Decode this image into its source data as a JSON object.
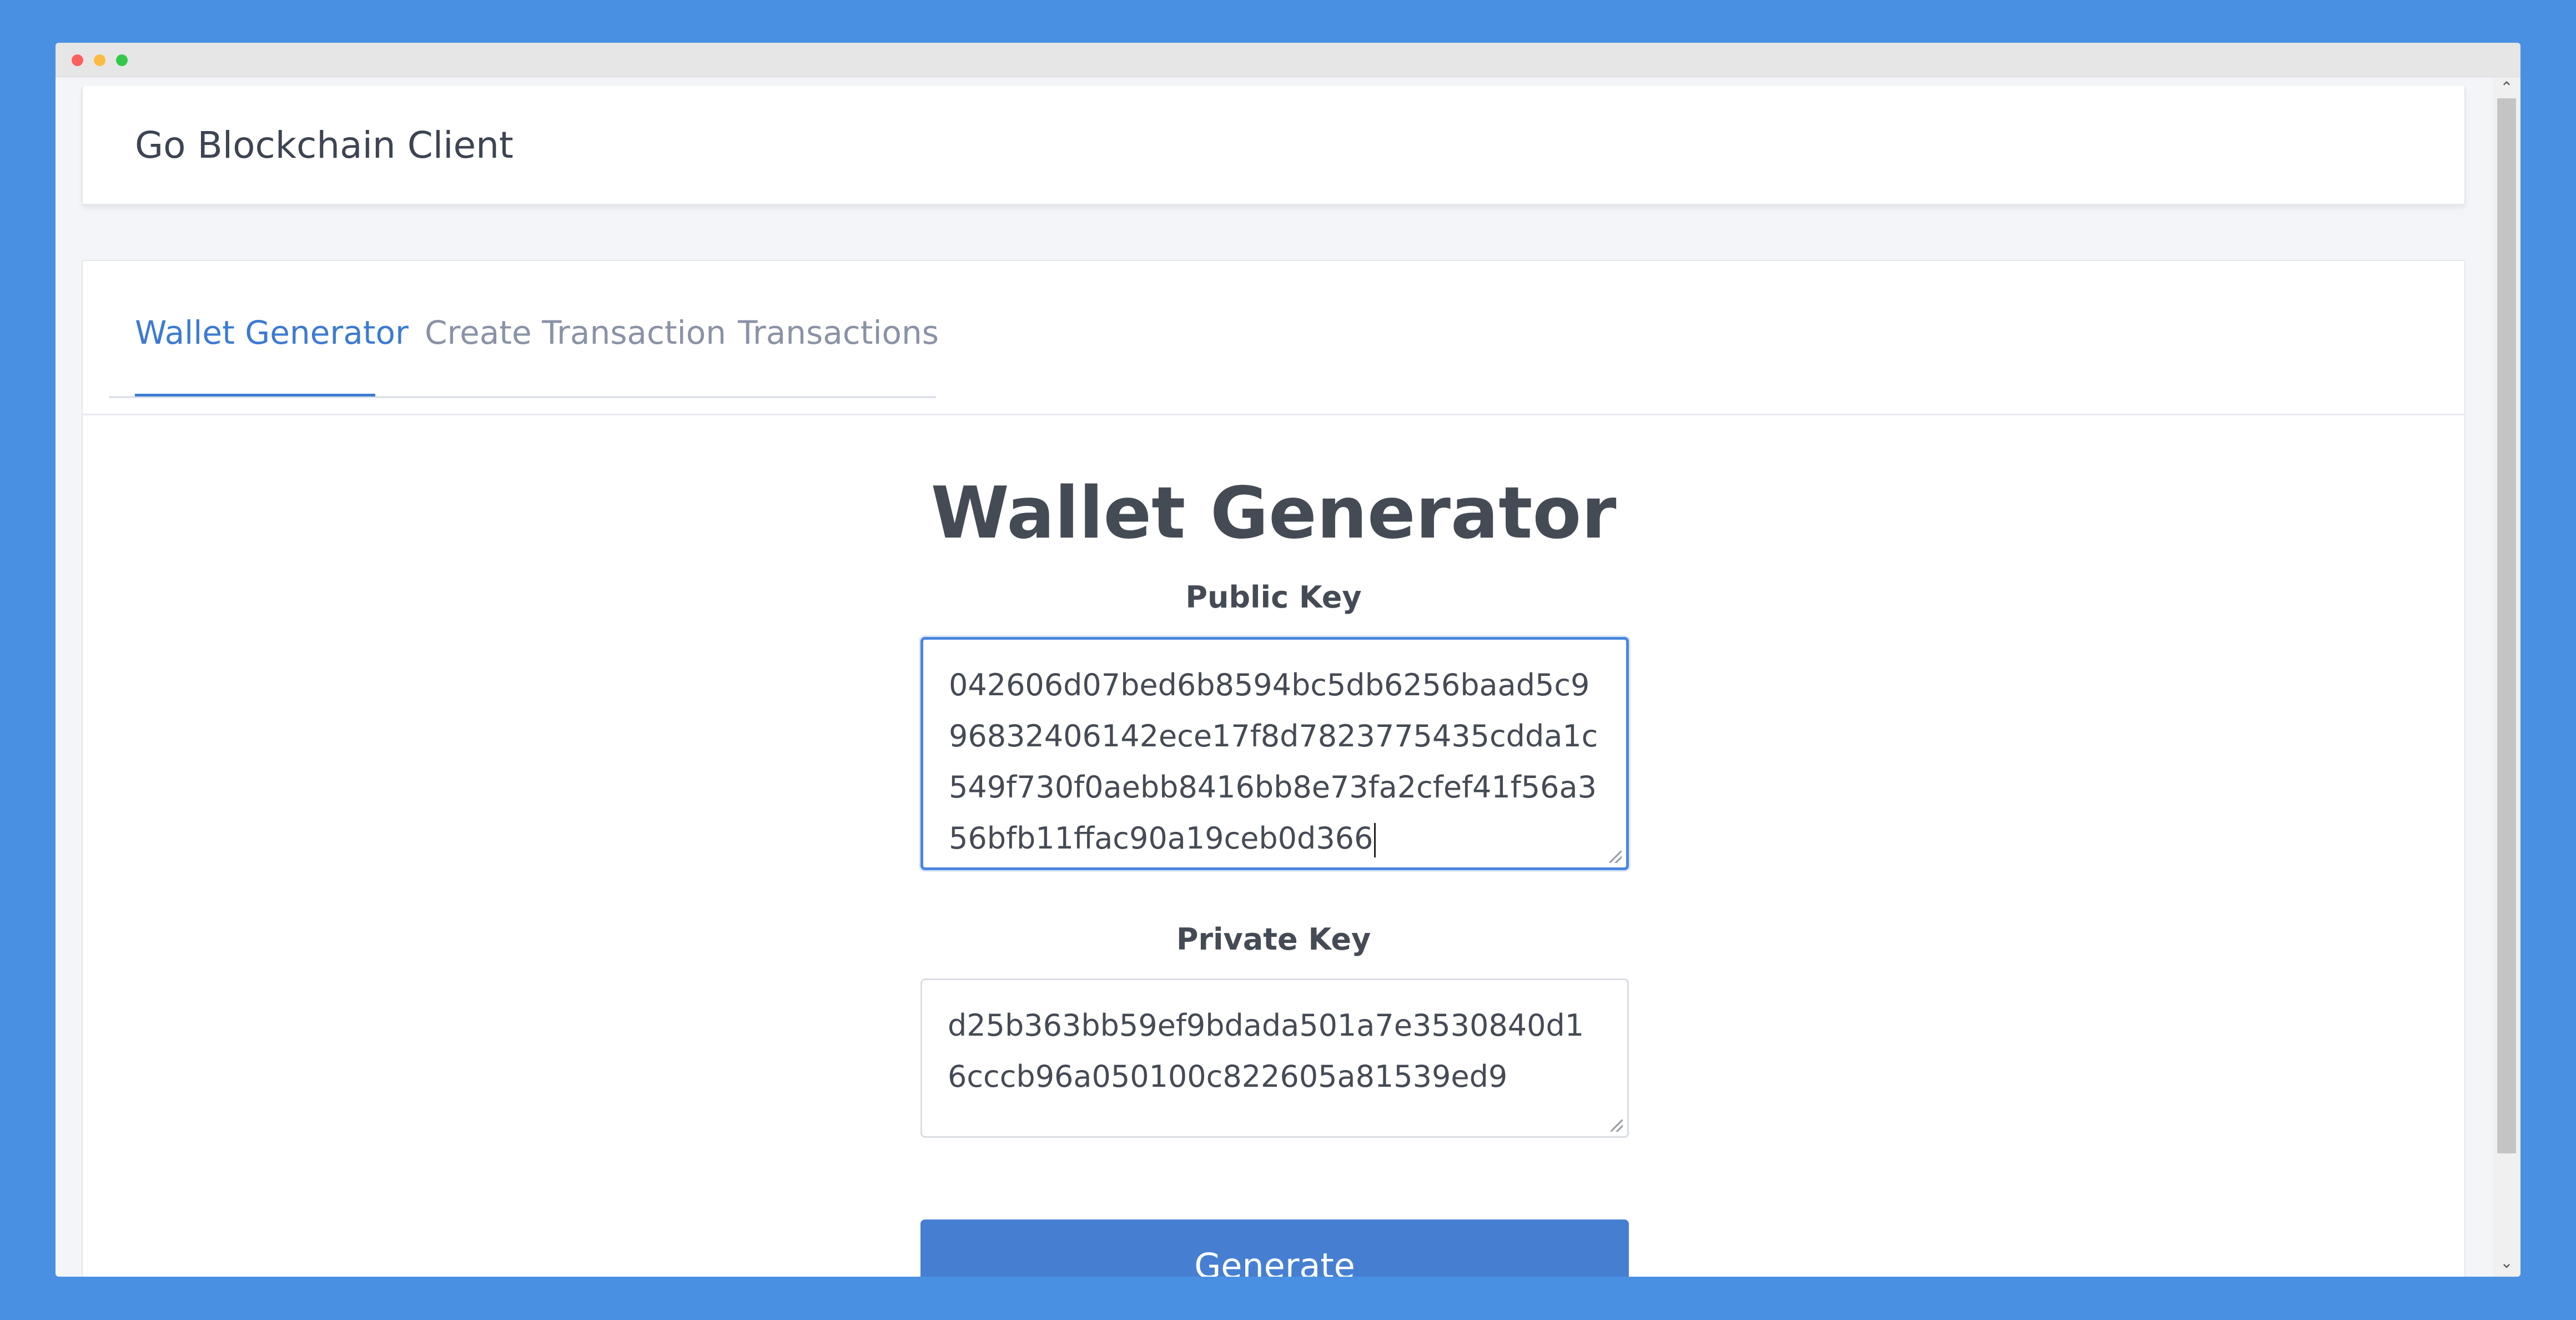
{
  "app": {
    "brand": "Go Blockchain Client"
  },
  "tabs": [
    {
      "label": "Wallet Generator",
      "active": true
    },
    {
      "label": "Create Transaction",
      "active": false
    },
    {
      "label": "Transactions",
      "active": false
    }
  ],
  "wallet": {
    "title": "Wallet Generator",
    "public_key_label": "Public Key",
    "public_key_value": "042606d07bed6b8594bc5db6256baad5c996832406142ece17f8d7823775435cdda1c549f730f0aebb8416bb8e73fa2cfef41f56a356bfb11ffac90a19ceb0d366",
    "private_key_label": "Private Key",
    "private_key_value": "d25b363bb59ef9bdada501a7e3530840d16cccb96a050100c822605a81539ed9",
    "generate_label": "Generate"
  },
  "icons": {
    "scroll_up": "chevron-up-icon",
    "scroll_down": "chevron-down-icon"
  },
  "colors": {
    "background": "#4a90e2",
    "accent": "#3c7bd2",
    "button": "#467fd2"
  }
}
